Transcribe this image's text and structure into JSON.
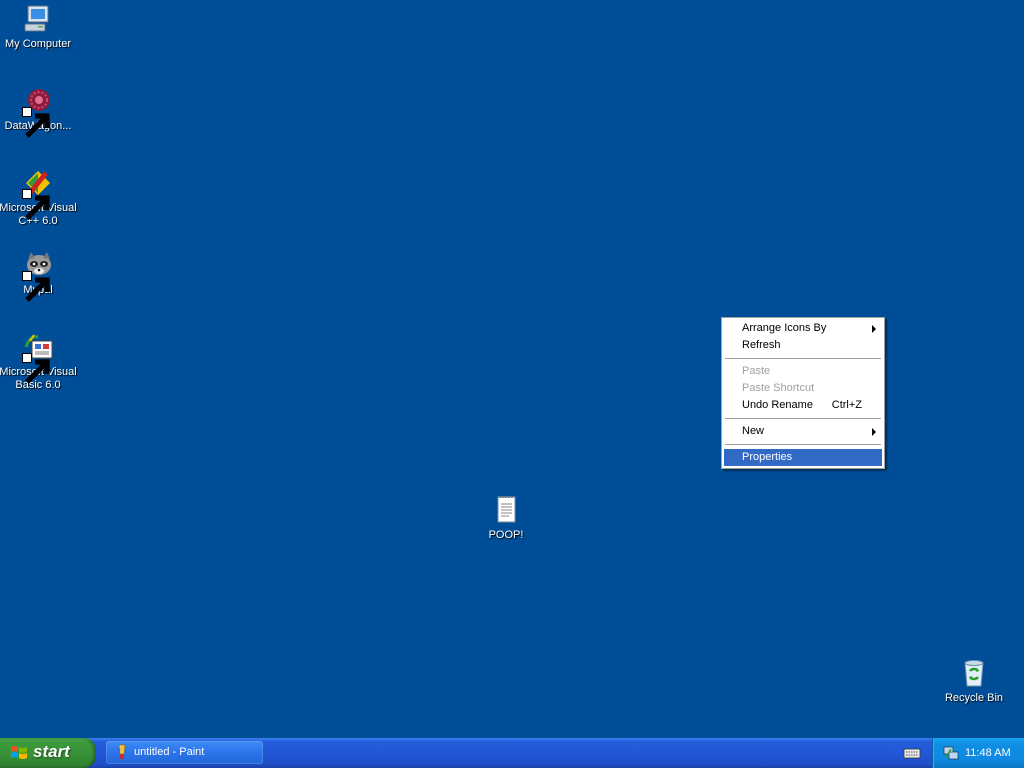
{
  "colors": {
    "desktop": "#004e98",
    "menu_highlight": "#316ac5",
    "start_green": "#3c9a3c",
    "taskbar_blue": "#245edb",
    "tray_blue": "#0f8ee3"
  },
  "desktop_icons": [
    {
      "label": "My Computer",
      "icon": "computer-icon"
    },
    {
      "label": "DataWagon...",
      "icon": "datawagon-icon"
    },
    {
      "label": "Microsoft Visual C++ 6.0",
      "icon": "visual-cpp-icon"
    },
    {
      "label": "Mypal",
      "icon": "mypal-icon"
    },
    {
      "label": "Microsoft Visual Basic 6.0",
      "icon": "visual-basic-icon"
    },
    {
      "label": "POOP!",
      "icon": "notepad-file-icon"
    },
    {
      "label": "Recycle Bin",
      "icon": "recycle-bin-icon"
    }
  ],
  "context_menu": {
    "items": [
      {
        "label": "Arrange Icons By"
      },
      {
        "label": "Refresh"
      },
      {
        "label": "Paste"
      },
      {
        "label": "Paste Shortcut"
      },
      {
        "label": "Undo Rename",
        "shortcut": "Ctrl+Z"
      },
      {
        "label": "New"
      },
      {
        "label": "Properties"
      }
    ]
  },
  "taskbar": {
    "start_label": "start",
    "tasks": [
      {
        "label": "untitled - Paint",
        "icon": "paint-icon"
      }
    ],
    "clock": "11:48 AM"
  }
}
